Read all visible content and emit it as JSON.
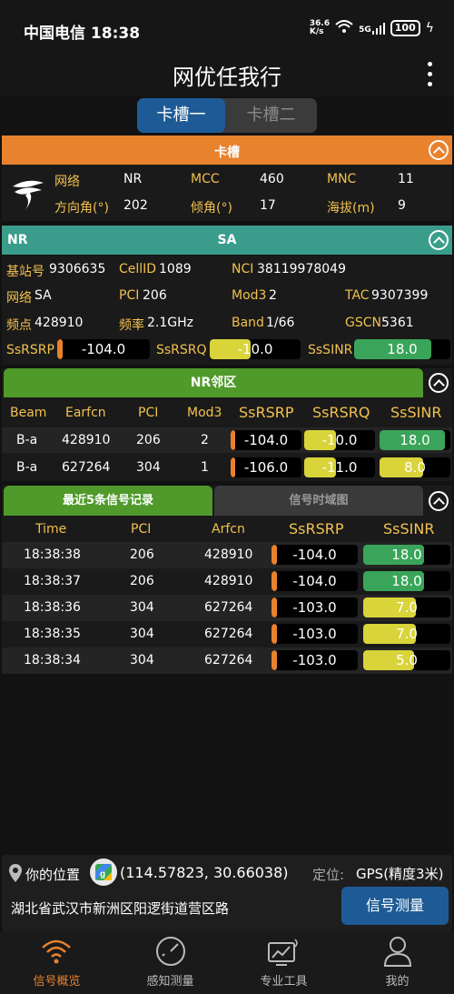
{
  "status": {
    "time": "中国电信 18:38",
    "speed": "36.6\nK/s",
    "wifi": "wifi-icon",
    "net": "5G",
    "battery": "100"
  },
  "app": {
    "title": "网优任我行"
  },
  "slot_tabs": [
    "卡槽一",
    "卡槽二"
  ],
  "card_section": {
    "header": "卡槽",
    "rows": [
      [
        {
          "label": "网络",
          "value": "NR"
        },
        {
          "label": "MCC",
          "value": "460"
        },
        {
          "label": "MNC",
          "value": "11"
        }
      ],
      [
        {
          "label": "方向角(°)",
          "value": "202"
        },
        {
          "label": "倾角(°)",
          "value": "17"
        },
        {
          "label": "海拔(m)",
          "value": "9"
        }
      ]
    ]
  },
  "nr_section": {
    "header_left": "NR",
    "header_center": "SA",
    "rows": [
      [
        {
          "label": "基站号",
          "value": "9306635"
        },
        {
          "label": "CellID",
          "value": "1089"
        },
        {
          "label": "NCI",
          "value": "38119978049"
        }
      ],
      [
        {
          "label": "网络",
          "value": "SA"
        },
        {
          "label": "PCI",
          "value": "206"
        },
        {
          "label": "Mod3",
          "value": "2"
        },
        {
          "label": "TAC",
          "value": "9307399"
        }
      ],
      [
        {
          "label": "频点",
          "value": "428910"
        },
        {
          "label": "频率",
          "value": "2.1GHz"
        },
        {
          "label": "Band",
          "value": "1/66"
        },
        {
          "label": "GSCN",
          "value": "5361"
        }
      ]
    ],
    "signal": [
      {
        "label": "SsRSRP",
        "value": "-104.0",
        "level": 0.04,
        "color": "#e8822d"
      },
      {
        "label": "SsRSRQ",
        "value": "-10.0",
        "level": 0.45,
        "color": "#d9d43a"
      },
      {
        "label": "SsSINR",
        "value": "18.0",
        "level": 0.8,
        "color": "#3aa55a"
      }
    ]
  },
  "neighbor_section": {
    "header": "NR邻区",
    "columns": [
      "Beam",
      "Earfcn",
      "PCI",
      "Mod3",
      "SsRSRP",
      "SsRSRQ",
      "SsSINR"
    ],
    "rows": [
      {
        "beam": "B-a",
        "earfcn": "428910",
        "pci": "206",
        "mod3": "2",
        "rsrp": {
          "value": "-104.0",
          "level": 0.04,
          "color": "#e8822d"
        },
        "rsrq": {
          "value": "-10.0",
          "level": 0.45,
          "color": "#d9d43a"
        },
        "sinr": {
          "value": "18.0",
          "level": 0.92,
          "color": "#3aa55a"
        }
      },
      {
        "beam": "B-a",
        "earfcn": "627264",
        "pci": "304",
        "mod3": "1",
        "rsrp": {
          "value": "-106.0",
          "level": 0.04,
          "color": "#e8822d"
        },
        "rsrq": {
          "value": "-11.0",
          "level": 0.45,
          "color": "#d9d43a"
        },
        "sinr": {
          "value": "8.0",
          "level": 0.62,
          "color": "#d9d43a"
        }
      }
    ]
  },
  "records_section": {
    "tabs": [
      "最近5条信号记录",
      "信号时域图"
    ],
    "columns": [
      "Time",
      "PCI",
      "Arfcn",
      "SsRSRP",
      "SsSINR"
    ],
    "rows": [
      {
        "time": "18:38:38",
        "pci": "206",
        "arfcn": "428910",
        "rsrp": {
          "value": "-104.0",
          "level": 0.04,
          "color": "#e8822d"
        },
        "sinr": {
          "value": "18.0",
          "level": 0.7,
          "color": "#3aa55a"
        }
      },
      {
        "time": "18:38:37",
        "pci": "206",
        "arfcn": "428910",
        "rsrp": {
          "value": "-104.0",
          "level": 0.04,
          "color": "#e8822d"
        },
        "sinr": {
          "value": "18.0",
          "level": 0.7,
          "color": "#3aa55a"
        }
      },
      {
        "time": "18:38:36",
        "pci": "304",
        "arfcn": "627264",
        "rsrp": {
          "value": "-103.0",
          "level": 0.04,
          "color": "#e8822d"
        },
        "sinr": {
          "value": "7.0",
          "level": 0.6,
          "color": "#d9d43a"
        }
      },
      {
        "time": "18:38:35",
        "pci": "304",
        "arfcn": "627264",
        "rsrp": {
          "value": "-103.0",
          "level": 0.04,
          "color": "#e8822d"
        },
        "sinr": {
          "value": "7.0",
          "level": 0.6,
          "color": "#d9d43a"
        }
      },
      {
        "time": "18:38:34",
        "pci": "304",
        "arfcn": "627264",
        "rsrp": {
          "value": "-103.0",
          "level": 0.04,
          "color": "#e8822d"
        },
        "sinr": {
          "value": "5.0",
          "level": 0.58,
          "color": "#d9d43a"
        }
      }
    ]
  },
  "location": {
    "label": "你的位置",
    "coords": "(114.57823, 30.66038)",
    "fix_label": "定位:",
    "fix_value": "GPS(精度3米)",
    "address": "湖北省武汉市新洲区阳逻街道营区路",
    "measure_button": "信号测量"
  },
  "nav": [
    {
      "label": "信号概览",
      "icon": "wifi-signal-icon",
      "active": true
    },
    {
      "label": "感知测量",
      "icon": "gauge-icon",
      "active": false
    },
    {
      "label": "专业工具",
      "icon": "monitor-chart-icon",
      "active": false
    },
    {
      "label": "我的",
      "icon": "person-icon",
      "active": false
    }
  ],
  "colors": {
    "accent_orange": "#e8822d",
    "teal": "#3a9d8c",
    "green": "#4f9a2a",
    "blue_button": "#1e5b96",
    "label_yellow": "#f2c14e"
  }
}
